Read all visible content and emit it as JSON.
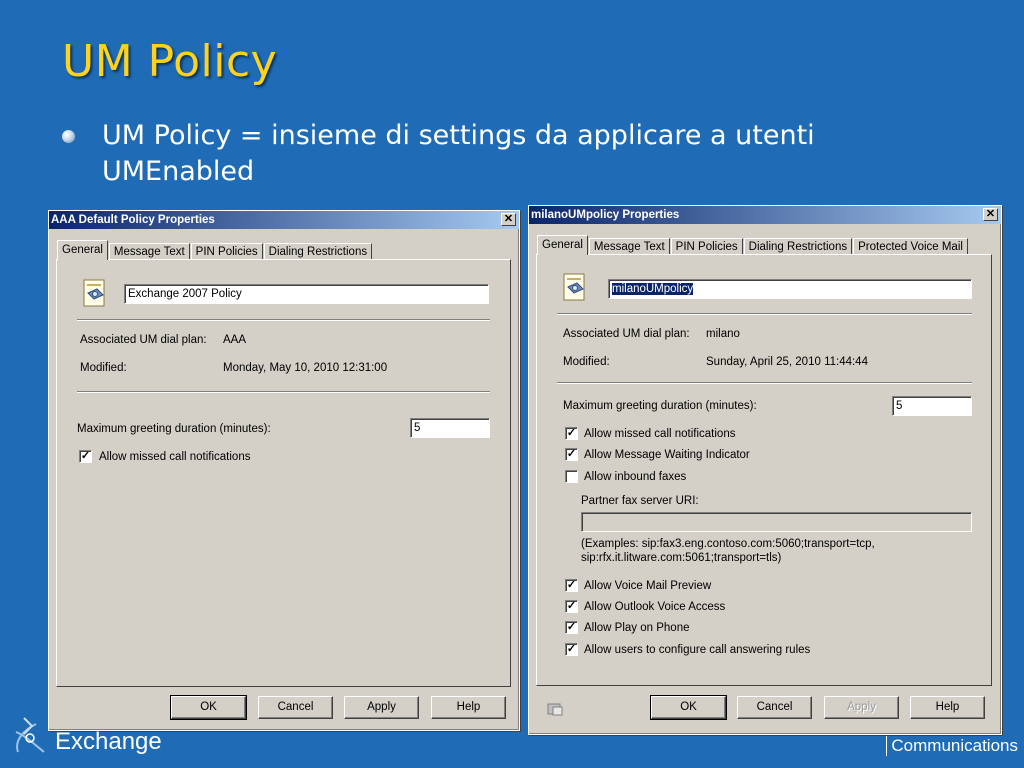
{
  "slide": {
    "title": "UM Policy",
    "bullet": "UM Policy = insieme di settings da applicare a utenti UMEnabled",
    "footer_brand": "Exchange",
    "footer_right": "Communications"
  },
  "dialog_left": {
    "title": "AAA Default Policy Properties",
    "tabs": [
      "General",
      "Message Text",
      "PIN Policies",
      "Dialing Restrictions"
    ],
    "name_value": "Exchange 2007 Policy",
    "dial_plan_label": "Associated UM dial plan:",
    "dial_plan_value": "AAA",
    "modified_label": "Modified:",
    "modified_value": "Monday, May 10, 2010 12:31:00",
    "greeting_label": "Maximum greeting duration (minutes):",
    "greeting_value": "5",
    "missed_call_label": "Allow missed call notifications",
    "missed_call_checked": "✓",
    "buttons": {
      "ok": "OK",
      "cancel": "Cancel",
      "apply": "Apply",
      "help": "Help"
    }
  },
  "dialog_right": {
    "title": "milanoUMpolicy Properties",
    "tabs": [
      "General",
      "Message Text",
      "PIN Policies",
      "Dialing Restrictions",
      "Protected Voice Mail"
    ],
    "name_value": "milanoUMpolicy",
    "dial_plan_label": "Associated UM dial plan:",
    "dial_plan_value": "milano",
    "modified_label": "Modified:",
    "modified_value": "Sunday, April 25, 2010 11:44:44",
    "greeting_label": "Maximum greeting duration (minutes):",
    "greeting_value": "5",
    "checks_top": [
      {
        "label": "Allow missed call notifications",
        "mark": "✓"
      },
      {
        "label": "Allow Message Waiting Indicator",
        "mark": "✓"
      },
      {
        "label": "Allow inbound faxes",
        "mark": ""
      }
    ],
    "fax_uri_label": "Partner fax server URI:",
    "fax_uri_value": "",
    "examples_line1": "(Examples: sip:fax3.eng.contoso.com:5060;transport=tcp,",
    "examples_line2": "sip:rfx.it.litware.com:5061;transport=tls)",
    "checks_bottom": [
      {
        "label": "Allow Voice Mail Preview",
        "mark": "✓"
      },
      {
        "label": "Allow Outlook Voice Access",
        "mark": "✓"
      },
      {
        "label": "Allow Play on Phone",
        "mark": "✓"
      },
      {
        "label": "Allow users to configure call answering rules",
        "mark": "✓"
      }
    ],
    "buttons": {
      "ok": "OK",
      "cancel": "Cancel",
      "apply": "Apply",
      "help": "Help"
    }
  },
  "icons": {
    "policy": "policy-document-icon",
    "close": "close-icon",
    "settings": "settings-icon",
    "logo": "exchange-logo-icon",
    "bullet": "bullet-icon"
  },
  "colors": {
    "background": "#1f6bb5",
    "title": "#ffd21f",
    "titlebar_start": "#0a246a",
    "titlebar_end": "#a6caf0",
    "dialog_face": "#d4d0c8"
  }
}
